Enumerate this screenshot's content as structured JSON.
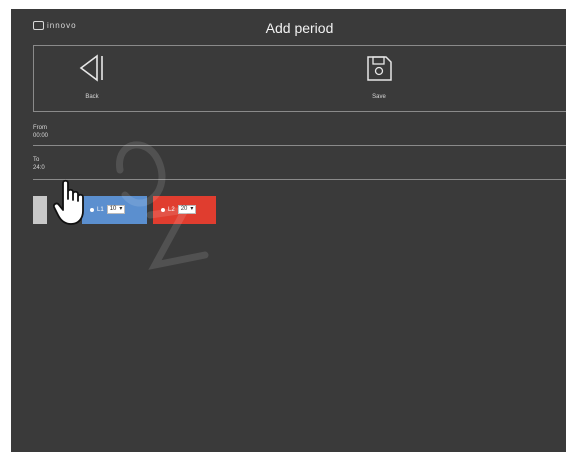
{
  "header": {
    "logo_text": "innovo",
    "title": "Add period"
  },
  "toolbar": {
    "back_label": "Back",
    "save_label": "Save"
  },
  "form": {
    "from_label": "From",
    "from_value": "00:00",
    "to_label": "To",
    "to_value": "24:0"
  },
  "lights": [
    {
      "label": "L1",
      "value": "10",
      "color": "#5b8fcf"
    },
    {
      "label": "L2",
      "value": "20",
      "color": "#e03d2f"
    }
  ],
  "icons": {
    "back": "back-triangle-icon",
    "save": "floppy-disk-icon",
    "pointer": "hand-pointer-icon",
    "dropdown": "chevron-down-icon"
  }
}
